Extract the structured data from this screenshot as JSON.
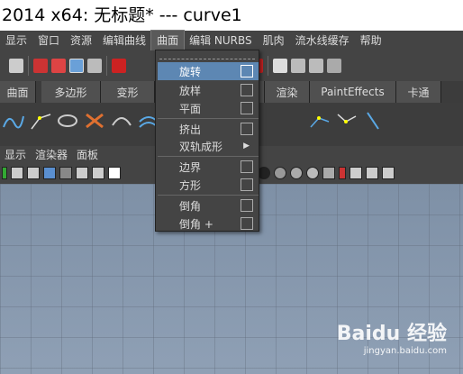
{
  "window": {
    "title": "2014 x64: 无标题*    ---    curve1"
  },
  "menubar": {
    "items": [
      "显示",
      "窗口",
      "资源",
      "编辑曲线",
      "曲面",
      "编辑 NURBS",
      "肌肉",
      "流水线缓存",
      "帮助"
    ],
    "active_index": 4
  },
  "shelf_tabs": [
    "曲面",
    "多边形",
    "变形",
    "",
    "渲染",
    "PaintEffects",
    "卡通"
  ],
  "panel_menu": [
    "显示",
    "渲染器",
    "面板"
  ],
  "dropdown": {
    "items": [
      {
        "label": "旋转",
        "has_option_box": true,
        "highlighted": true
      },
      {
        "label": "放样",
        "has_option_box": true
      },
      {
        "label": "平面",
        "has_option_box": true
      },
      {
        "label": "挤出",
        "has_option_box": true
      },
      {
        "label": "双轨成形",
        "has_submenu": true
      },
      {
        "label": "边界",
        "has_option_box": true
      },
      {
        "label": "方形",
        "has_option_box": true
      },
      {
        "label": "倒角",
        "has_option_box": true
      },
      {
        "label": "倒角 +",
        "has_option_box": true
      }
    ]
  },
  "watermark": {
    "brand": "Baidu 经验",
    "url": "jingyan.baidu.com"
  },
  "colors": {
    "highlight": "#5d87b3",
    "panel": "#444444",
    "viewport": "#8a9bb0"
  }
}
